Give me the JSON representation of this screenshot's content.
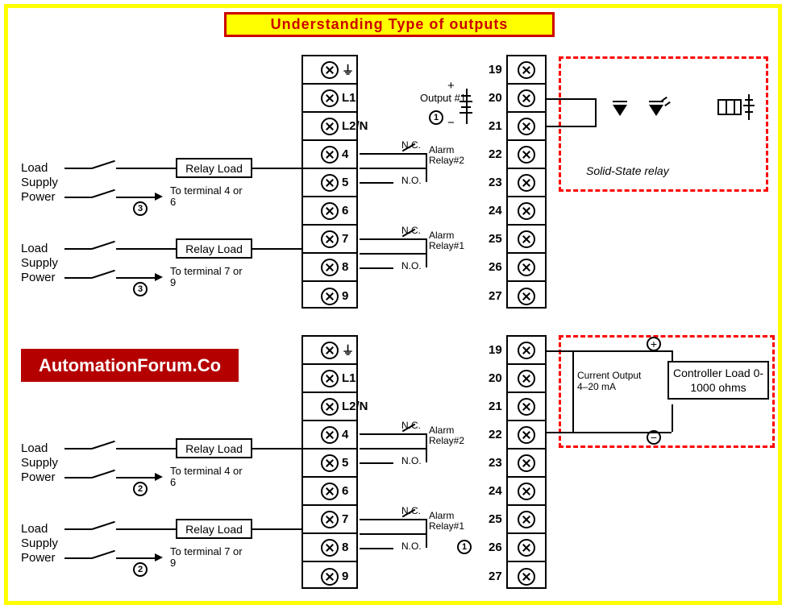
{
  "title": "Understanding Type of outputs",
  "logo": "AutomationForum.Co",
  "power_labels": {
    "ground": "⏚",
    "l1": "L1",
    "l2": "L2/N"
  },
  "left_numbers_a": [
    "4",
    "5",
    "6",
    "7",
    "8",
    "9"
  ],
  "right_numbers": [
    "19",
    "20",
    "21",
    "22",
    "23",
    "24",
    "25",
    "26",
    "27"
  ],
  "load_lines": {
    "load": "Load",
    "supply": "Supply",
    "power": "Power"
  },
  "relay_load": "Relay Load",
  "to_terminal_46": "To terminal 4 or 6",
  "to_terminal_79": "To terminal 7 or 9",
  "alarm": {
    "nc": "N.C.",
    "no": "N.O.",
    "r2": "Alarm Relay#2",
    "r1": "Alarm Relay#1"
  },
  "output1": "Output #1",
  "ssr_label": "Solid-State relay",
  "current_output": "Current Output 4–20 mA",
  "controller_load": "Controller Load 0-1000 ohms",
  "circ": {
    "one": "1",
    "two": "2",
    "three": "3"
  },
  "signs": {
    "plus": "+",
    "minus": "−",
    "oplus": "⊕",
    "ominus": "⊖"
  }
}
